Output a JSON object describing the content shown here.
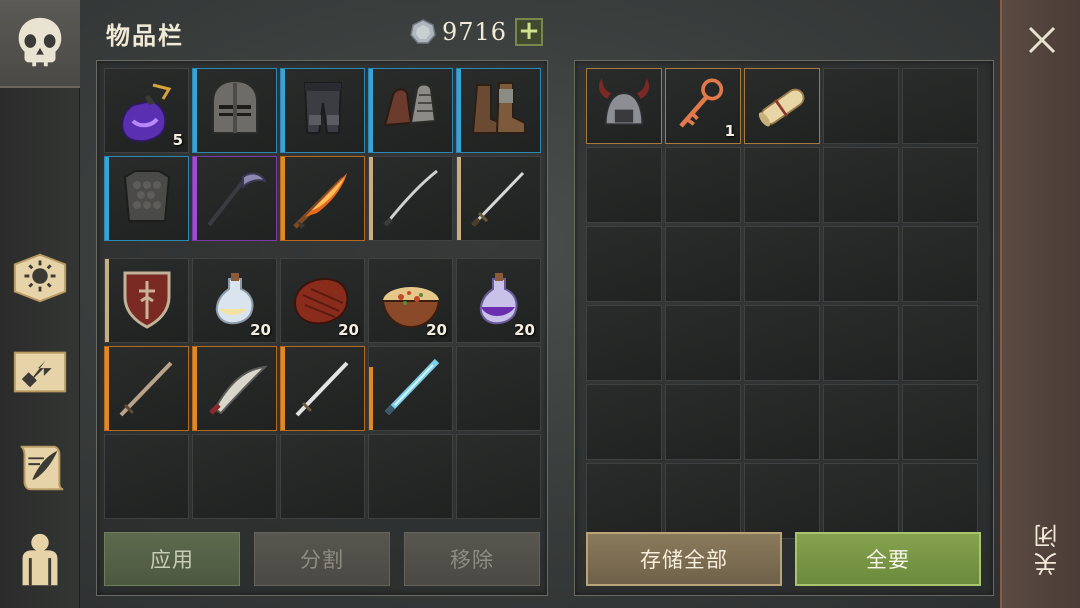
{
  "header": {
    "title": "物品栏",
    "currency_amount": "9716",
    "plus_label": "+"
  },
  "nav": [
    {
      "icon": "skull-icon",
      "active": true
    },
    {
      "icon": "sun-book-icon",
      "active": false
    },
    {
      "icon": "arrow-map-icon",
      "active": false
    },
    {
      "icon": "scroll-quill-icon",
      "active": false
    },
    {
      "icon": "character-silhouette-icon",
      "active": false
    }
  ],
  "inventory_top": [
    {
      "name": "potion-amulet",
      "rarity": "none",
      "qty": "5"
    },
    {
      "name": "knight-helmet",
      "rarity": "blue",
      "qty": ""
    },
    {
      "name": "leather-pants",
      "rarity": "blue",
      "qty": ""
    },
    {
      "name": "plate-gauntlets",
      "rarity": "blue",
      "qty": ""
    },
    {
      "name": "leather-boots",
      "rarity": "blue",
      "qty": ""
    },
    {
      "name": "scale-armor",
      "rarity": "blue",
      "qty": ""
    },
    {
      "name": "scythe",
      "rarity": "purple",
      "qty": ""
    },
    {
      "name": "flame-sword",
      "rarity": "orange",
      "qty": ""
    },
    {
      "name": "katana",
      "rarity": "tan",
      "qty": ""
    },
    {
      "name": "longsword",
      "rarity": "tan",
      "qty": ""
    }
  ],
  "inventory_bottom": [
    {
      "name": "red-shield",
      "rarity": "tan",
      "qty": ""
    },
    {
      "name": "light-potion",
      "rarity": "none",
      "qty": "20"
    },
    {
      "name": "steak",
      "rarity": "none",
      "qty": "20"
    },
    {
      "name": "soup-bowl",
      "rarity": "none",
      "qty": "20"
    },
    {
      "name": "purple-potion",
      "rarity": "none",
      "qty": "20"
    },
    {
      "name": "wooden-sword",
      "rarity": "orange",
      "qty": ""
    },
    {
      "name": "scimitar",
      "rarity": "orange",
      "qty": ""
    },
    {
      "name": "steel-sword",
      "rarity": "orange",
      "qty": ""
    },
    {
      "name": "ice-sword",
      "rarity": "faded-orange",
      "qty": ""
    },
    {
      "name": "",
      "rarity": "none",
      "qty": ""
    },
    {
      "name": "",
      "rarity": "none",
      "qty": ""
    },
    {
      "name": "",
      "rarity": "none",
      "qty": ""
    },
    {
      "name": "",
      "rarity": "none",
      "qty": ""
    },
    {
      "name": "",
      "rarity": "none",
      "qty": ""
    },
    {
      "name": "",
      "rarity": "none",
      "qty": ""
    }
  ],
  "storage": [
    {
      "name": "horned-helmet",
      "qty": ""
    },
    {
      "name": "ornate-key",
      "qty": "1"
    },
    {
      "name": "scroll-bundle",
      "qty": ""
    }
  ],
  "buttons": {
    "apply": "应用",
    "split": "分割",
    "remove": "移除",
    "store_all": "存储全部",
    "take_all": "全要"
  },
  "close": {
    "label": "关闭"
  },
  "colors": {
    "blue": "#3aa3d6",
    "purple": "#9b4fd0",
    "orange": "#e08a24",
    "tan": "#c7ae83",
    "take_button": "#7a9946",
    "store_button": "#7d6e52"
  }
}
